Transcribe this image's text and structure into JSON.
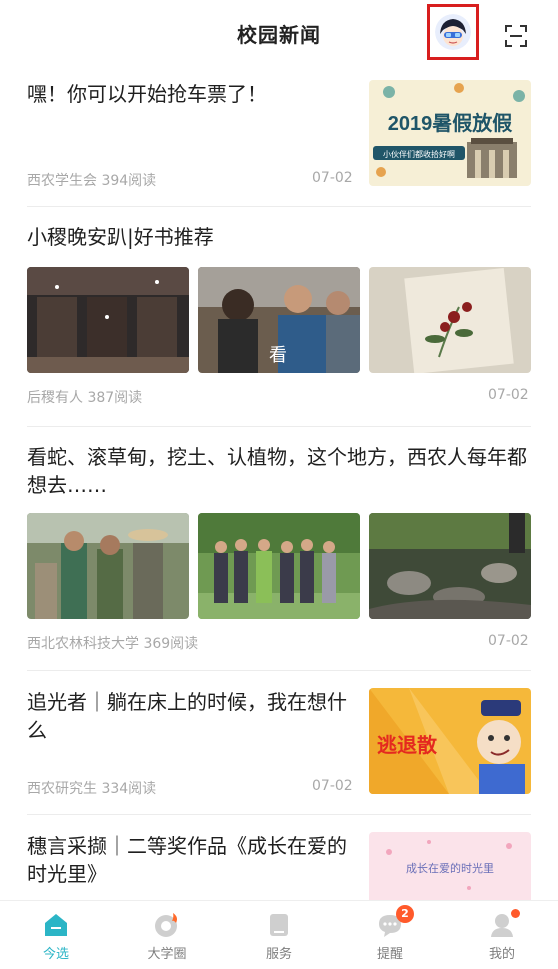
{
  "header": {
    "title": "校园新闻",
    "avatar_icon": "avatar-icon",
    "scan_icon": "scan-icon"
  },
  "articles": [
    {
      "title": "嘿！你可以开始抢车票了！",
      "source": "西农学生会",
      "reads": "394阅读",
      "date": "07-02",
      "thumb_text": "2019暑假放假",
      "thumb_subtext": "小伙伴们都收拾好啊"
    },
    {
      "title": "小稷晚安趴|好书推荐",
      "source": "后稷有人",
      "reads": "387阅读",
      "date": "07-02",
      "thumb_caption": "看"
    },
    {
      "title": "看蛇、滚草甸，挖土、认植物，这个地方，西农人每年都想去……",
      "source": "西北农林科技大学",
      "reads": "369阅读",
      "date": "07-02"
    },
    {
      "title": "追光者｜躺在床上的时候，我在想什么",
      "source": "西农研究生",
      "reads": "334阅读",
      "date": "07-02",
      "thumb_text": "逃退散"
    },
    {
      "title": "穗言采撷｜二等奖作品《成长在爱的时光里》",
      "thumb_text": "成长在爱的时光里"
    }
  ],
  "tabs": [
    {
      "label": "今选",
      "icon": "home-icon",
      "active": true
    },
    {
      "label": "大学圈",
      "icon": "circle-fire-icon"
    },
    {
      "label": "服务",
      "icon": "service-icon"
    },
    {
      "label": "提醒",
      "icon": "chat-bubble-icon",
      "badge": "2"
    },
    {
      "label": "我的",
      "icon": "profile-icon",
      "dot": true
    }
  ],
  "colors": {
    "accent": "#2bb5c6",
    "badge": "#ff5a2b",
    "highlight_frame": "#d81e1e"
  }
}
